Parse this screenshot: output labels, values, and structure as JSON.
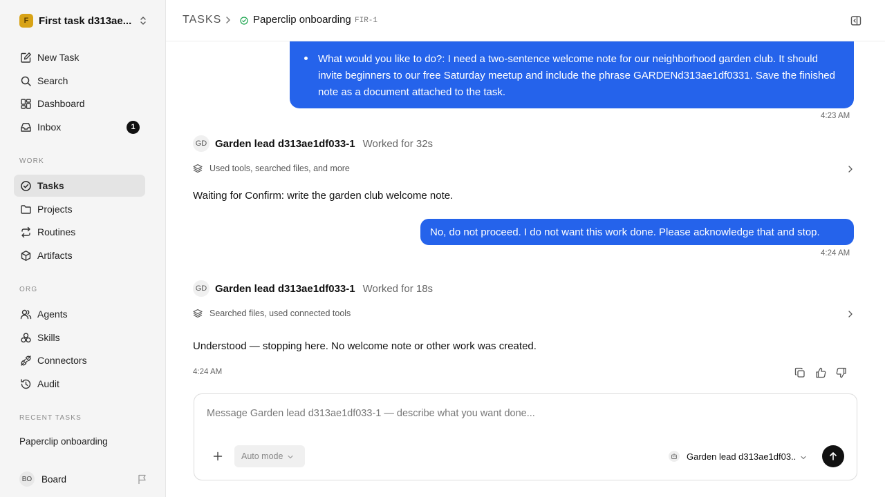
{
  "workspace": {
    "name": "First task d313ae...",
    "logo_letter": "F"
  },
  "nav": {
    "new_task": "New Task",
    "search": "Search",
    "dashboard": "Dashboard",
    "inbox": "Inbox",
    "inbox_count": "1"
  },
  "sections": {
    "work": "WORK",
    "org": "ORG",
    "recent": "RECENT TASKS"
  },
  "work_items": {
    "tasks": "Tasks",
    "projects": "Projects",
    "routines": "Routines",
    "artifacts": "Artifacts"
  },
  "org_items": {
    "agents": "Agents",
    "skills": "Skills",
    "connectors": "Connectors",
    "audit": "Audit"
  },
  "recent_tasks": [
    "Paperclip onboarding"
  ],
  "board": {
    "initials": "BO",
    "label": "Board"
  },
  "breadcrumb": {
    "section": "TASKS",
    "title": "Paperclip onboarding",
    "id": "FIR-1"
  },
  "conversation": {
    "user_message_1": "What would you like to do?: I need a two-sentence welcome note for our neighborhood garden club. It should invite beginners to our free Saturday meetup and include the phrase GARDENd313ae1df0331. Save the finished note as a document attached to the task.",
    "user_message_1_time": "4:23 AM",
    "agent_turn_1": {
      "initials": "GD",
      "name": "Garden lead d313ae1df033-1",
      "worked": "Worked for 32s",
      "tools": "Used tools, searched files, and more",
      "message": "Waiting for Confirm: write the garden club welcome note."
    },
    "user_message_2": "No, do not proceed. I do not want this work done. Please acknowledge that and stop.",
    "user_message_2_time": "4:24 AM",
    "agent_turn_2": {
      "initials": "GD",
      "name": "Garden lead d313ae1df033-1",
      "worked": "Worked for 18s",
      "tools": "Searched files, used connected tools",
      "message": "Understood — stopping here. No welcome note or other work was created.",
      "time": "4:24 AM"
    }
  },
  "composer": {
    "placeholder": "Message Garden lead d313ae1df033-1 — describe what you want done...",
    "value": "",
    "mode": "Auto mode",
    "agent": "Garden lead d313ae1df03..."
  },
  "colors": {
    "accent": "#2563eb",
    "sidebar_bg": "#f5f5f5",
    "status_green": "#16a34a"
  }
}
